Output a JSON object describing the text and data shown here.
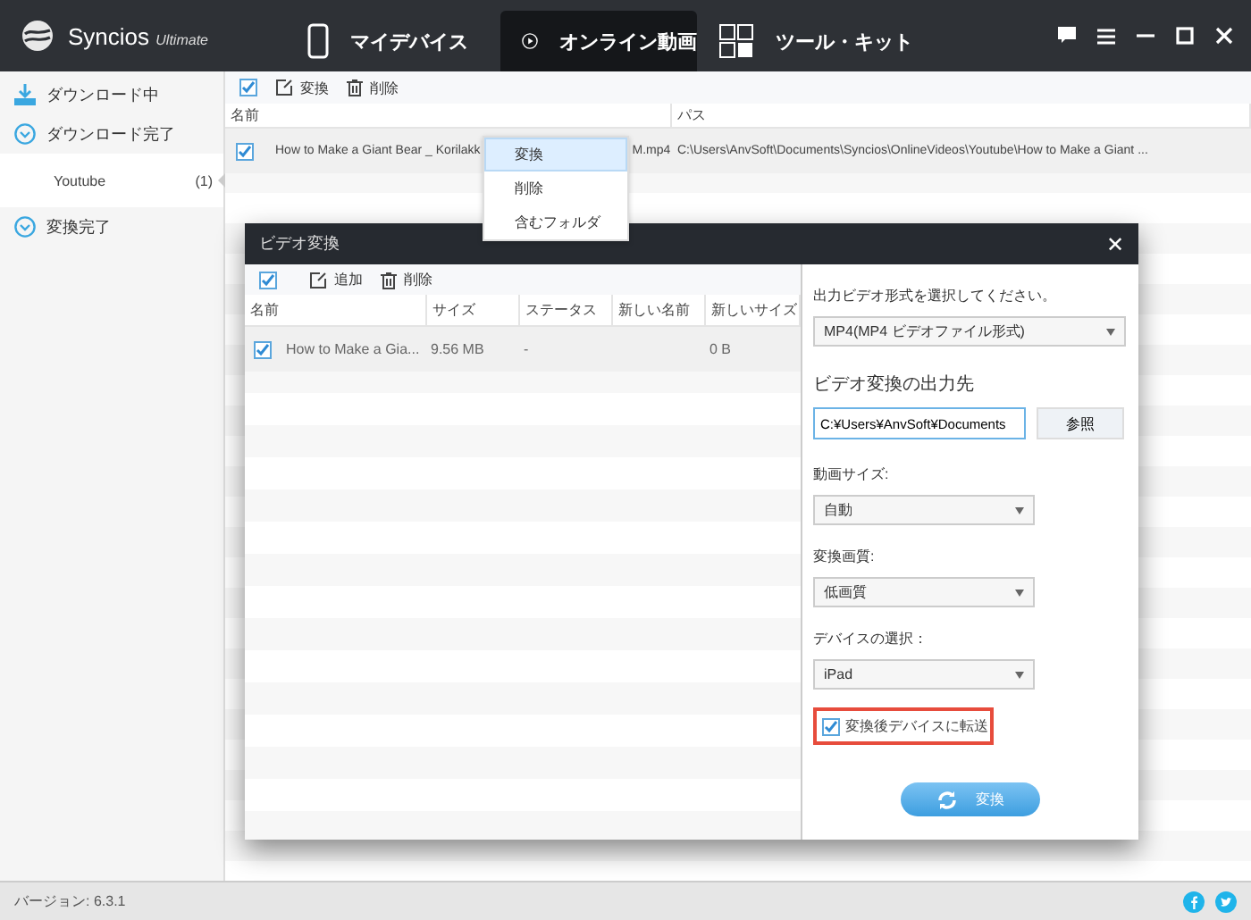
{
  "app": {
    "name": "Syncios",
    "edition": "Ultimate"
  },
  "nav_tabs": [
    {
      "label": "マイデバイス",
      "selected": false
    },
    {
      "label": "オンライン動画",
      "selected": true
    },
    {
      "label": "ツール・キット",
      "selected": false
    }
  ],
  "sidebar": {
    "items": [
      {
        "label": "ダウンロード中"
      },
      {
        "label": "ダウンロード完了",
        "children": [
          {
            "label": "Youtube",
            "count": "(1)",
            "selected": true
          }
        ]
      },
      {
        "label": "変換完了"
      }
    ]
  },
  "toolbar": {
    "checked": true,
    "buttons": [
      {
        "label": "変換"
      },
      {
        "label": "削除"
      }
    ]
  },
  "table": {
    "columns": [
      "名前",
      "パス"
    ],
    "rows": [
      {
        "checked": true,
        "name_start": "How to Make a Giant Bear _ Korilakk",
        "name_end": "M.mp4",
        "path": "C:\\Users\\AnvSoft\\Documents\\Syncios\\OnlineVideos\\Youtube\\How to Make a Giant ..."
      }
    ]
  },
  "context_menu": [
    {
      "label": "変換",
      "selected": true
    },
    {
      "label": "削除",
      "selected": false
    },
    {
      "label": "含むフォルダ",
      "selected": false
    }
  ],
  "dialog": {
    "title": "ビデオ変換",
    "close": "✕",
    "toolbar": {
      "checked": true,
      "buttons": [
        {
          "label": "追加"
        },
        {
          "label": "削除"
        }
      ]
    },
    "columns": [
      "名前",
      "サイズ",
      "ステータス",
      "新しい名前",
      "新しいサイズ"
    ],
    "rows": [
      {
        "checked": true,
        "cells": [
          "How to Make a Gia...",
          "9.56 MB",
          "-",
          "",
          "0 B"
        ]
      }
    ],
    "format_label": "出力ビデオ形式を選択してください。",
    "format_value": "MP4(MP4 ビデオファイル形式)",
    "output_label": "ビデオ変換の出力先",
    "output_value": "C:¥Users¥AnvSoft¥Documents",
    "browse": "参照",
    "selects": [
      {
        "label": "動画サイズ:",
        "value": "自動"
      },
      {
        "label": "変換画質:",
        "value": "低画質"
      },
      {
        "label": "デバイスの選択：",
        "value": "iPad"
      }
    ],
    "transfer": {
      "label": "変換後デバイスに転送",
      "checked": true
    },
    "convert": "変換"
  },
  "status_bar": {
    "version": "バージョン: 6.3.1"
  }
}
